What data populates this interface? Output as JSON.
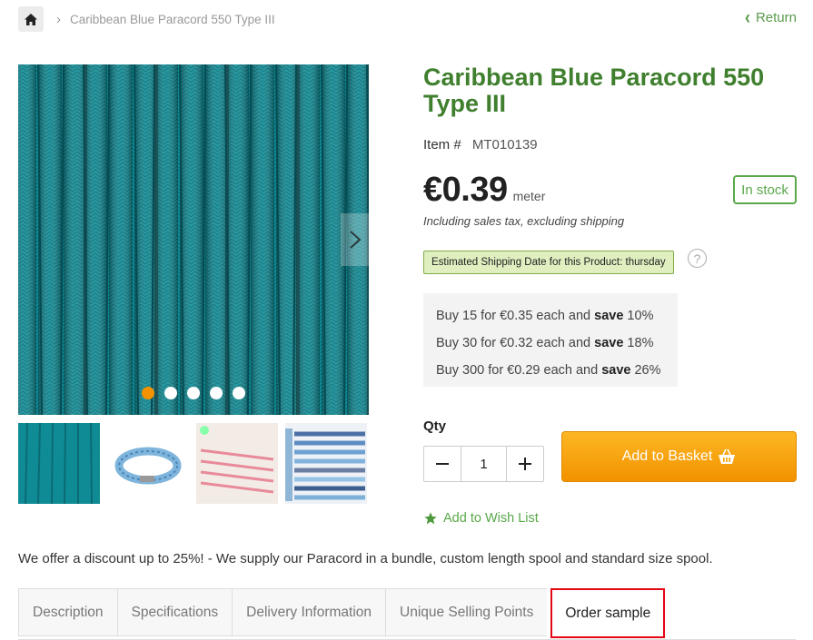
{
  "breadcrumb": {
    "home_icon": "home-icon",
    "separator_icon": "chevron-right-icon",
    "current": "Caribbean Blue Paracord 550 Type III"
  },
  "return_link": {
    "label": "Return",
    "icon": "chevron-left-icon"
  },
  "gallery": {
    "dots_count": 5,
    "active_dot": 0,
    "next_icon": "chevron-right-icon",
    "thumbnails": [
      "paracord-closeup",
      "paracord-bracelet",
      "paracord-color-card-pink",
      "paracord-color-card-blue"
    ]
  },
  "product": {
    "title": "Caribbean Blue Paracord 550 Type III",
    "item_label": "Item #",
    "item_number": "MT010139",
    "price": "€0.39",
    "unit": "meter",
    "stock": "In stock",
    "tax_note": "Including sales tax, excluding shipping",
    "shipping": "Estimated Shipping Date for this Product: thursday",
    "help_icon": "question-circle-icon"
  },
  "discounts": [
    {
      "prefix": "Buy 15 for €0.35 each and ",
      "save": "save",
      "pct": " 10%"
    },
    {
      "prefix": "Buy 30 for €0.32 each and ",
      "save": "save",
      "pct": " 18%"
    },
    {
      "prefix": "Buy 300 for €0.29 each and ",
      "save": "save",
      "pct": " 26%"
    }
  ],
  "purchase": {
    "qty_label": "Qty",
    "qty_value": "1",
    "minus_icon": "minus-icon",
    "plus_icon": "plus-icon",
    "add_label": "Add to Basket",
    "basket_icon": "basket-icon",
    "wishlist_label": "Add to Wish List",
    "wishlist_icon": "star-icon"
  },
  "promo": "We offer a discount up to 25%! - We supply our Paracord in a bundle, custom length spool and standard size spool.",
  "tabs": [
    {
      "label": "Description"
    },
    {
      "label": "Specifications"
    },
    {
      "label": "Delivery Information"
    },
    {
      "label": "Unique Selling Points"
    },
    {
      "label": "Order sample",
      "selected": true
    }
  ],
  "colors": {
    "title_green": "#3f7f2e",
    "accent_green": "#5aa84a",
    "orange": "#f39200",
    "highlight_red": "#e30613",
    "cord_teal": "#0e8c96"
  }
}
